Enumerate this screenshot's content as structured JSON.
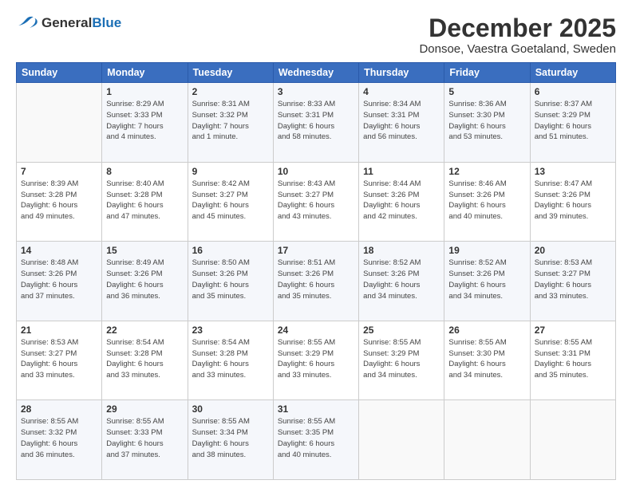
{
  "logo": {
    "line1": "General",
    "line2": "Blue"
  },
  "title": "December 2025",
  "subtitle": "Donsoe, Vaestra Goetaland, Sweden",
  "weekdays": [
    "Sunday",
    "Monday",
    "Tuesday",
    "Wednesday",
    "Thursday",
    "Friday",
    "Saturday"
  ],
  "weeks": [
    [
      {
        "day": "",
        "detail": ""
      },
      {
        "day": "1",
        "detail": "Sunrise: 8:29 AM\nSunset: 3:33 PM\nDaylight: 7 hours\nand 4 minutes."
      },
      {
        "day": "2",
        "detail": "Sunrise: 8:31 AM\nSunset: 3:32 PM\nDaylight: 7 hours\nand 1 minute."
      },
      {
        "day": "3",
        "detail": "Sunrise: 8:33 AM\nSunset: 3:31 PM\nDaylight: 6 hours\nand 58 minutes."
      },
      {
        "day": "4",
        "detail": "Sunrise: 8:34 AM\nSunset: 3:31 PM\nDaylight: 6 hours\nand 56 minutes."
      },
      {
        "day": "5",
        "detail": "Sunrise: 8:36 AM\nSunset: 3:30 PM\nDaylight: 6 hours\nand 53 minutes."
      },
      {
        "day": "6",
        "detail": "Sunrise: 8:37 AM\nSunset: 3:29 PM\nDaylight: 6 hours\nand 51 minutes."
      }
    ],
    [
      {
        "day": "7",
        "detail": "Sunrise: 8:39 AM\nSunset: 3:28 PM\nDaylight: 6 hours\nand 49 minutes."
      },
      {
        "day": "8",
        "detail": "Sunrise: 8:40 AM\nSunset: 3:28 PM\nDaylight: 6 hours\nand 47 minutes."
      },
      {
        "day": "9",
        "detail": "Sunrise: 8:42 AM\nSunset: 3:27 PM\nDaylight: 6 hours\nand 45 minutes."
      },
      {
        "day": "10",
        "detail": "Sunrise: 8:43 AM\nSunset: 3:27 PM\nDaylight: 6 hours\nand 43 minutes."
      },
      {
        "day": "11",
        "detail": "Sunrise: 8:44 AM\nSunset: 3:26 PM\nDaylight: 6 hours\nand 42 minutes."
      },
      {
        "day": "12",
        "detail": "Sunrise: 8:46 AM\nSunset: 3:26 PM\nDaylight: 6 hours\nand 40 minutes."
      },
      {
        "day": "13",
        "detail": "Sunrise: 8:47 AM\nSunset: 3:26 PM\nDaylight: 6 hours\nand 39 minutes."
      }
    ],
    [
      {
        "day": "14",
        "detail": "Sunrise: 8:48 AM\nSunset: 3:26 PM\nDaylight: 6 hours\nand 37 minutes."
      },
      {
        "day": "15",
        "detail": "Sunrise: 8:49 AM\nSunset: 3:26 PM\nDaylight: 6 hours\nand 36 minutes."
      },
      {
        "day": "16",
        "detail": "Sunrise: 8:50 AM\nSunset: 3:26 PM\nDaylight: 6 hours\nand 35 minutes."
      },
      {
        "day": "17",
        "detail": "Sunrise: 8:51 AM\nSunset: 3:26 PM\nDaylight: 6 hours\nand 35 minutes."
      },
      {
        "day": "18",
        "detail": "Sunrise: 8:52 AM\nSunset: 3:26 PM\nDaylight: 6 hours\nand 34 minutes."
      },
      {
        "day": "19",
        "detail": "Sunrise: 8:52 AM\nSunset: 3:26 PM\nDaylight: 6 hours\nand 34 minutes."
      },
      {
        "day": "20",
        "detail": "Sunrise: 8:53 AM\nSunset: 3:27 PM\nDaylight: 6 hours\nand 33 minutes."
      }
    ],
    [
      {
        "day": "21",
        "detail": "Sunrise: 8:53 AM\nSunset: 3:27 PM\nDaylight: 6 hours\nand 33 minutes."
      },
      {
        "day": "22",
        "detail": "Sunrise: 8:54 AM\nSunset: 3:28 PM\nDaylight: 6 hours\nand 33 minutes."
      },
      {
        "day": "23",
        "detail": "Sunrise: 8:54 AM\nSunset: 3:28 PM\nDaylight: 6 hours\nand 33 minutes."
      },
      {
        "day": "24",
        "detail": "Sunrise: 8:55 AM\nSunset: 3:29 PM\nDaylight: 6 hours\nand 33 minutes."
      },
      {
        "day": "25",
        "detail": "Sunrise: 8:55 AM\nSunset: 3:29 PM\nDaylight: 6 hours\nand 34 minutes."
      },
      {
        "day": "26",
        "detail": "Sunrise: 8:55 AM\nSunset: 3:30 PM\nDaylight: 6 hours\nand 34 minutes."
      },
      {
        "day": "27",
        "detail": "Sunrise: 8:55 AM\nSunset: 3:31 PM\nDaylight: 6 hours\nand 35 minutes."
      }
    ],
    [
      {
        "day": "28",
        "detail": "Sunrise: 8:55 AM\nSunset: 3:32 PM\nDaylight: 6 hours\nand 36 minutes."
      },
      {
        "day": "29",
        "detail": "Sunrise: 8:55 AM\nSunset: 3:33 PM\nDaylight: 6 hours\nand 37 minutes."
      },
      {
        "day": "30",
        "detail": "Sunrise: 8:55 AM\nSunset: 3:34 PM\nDaylight: 6 hours\nand 38 minutes."
      },
      {
        "day": "31",
        "detail": "Sunrise: 8:55 AM\nSunset: 3:35 PM\nDaylight: 6 hours\nand 40 minutes."
      },
      {
        "day": "",
        "detail": ""
      },
      {
        "day": "",
        "detail": ""
      },
      {
        "day": "",
        "detail": ""
      }
    ]
  ]
}
